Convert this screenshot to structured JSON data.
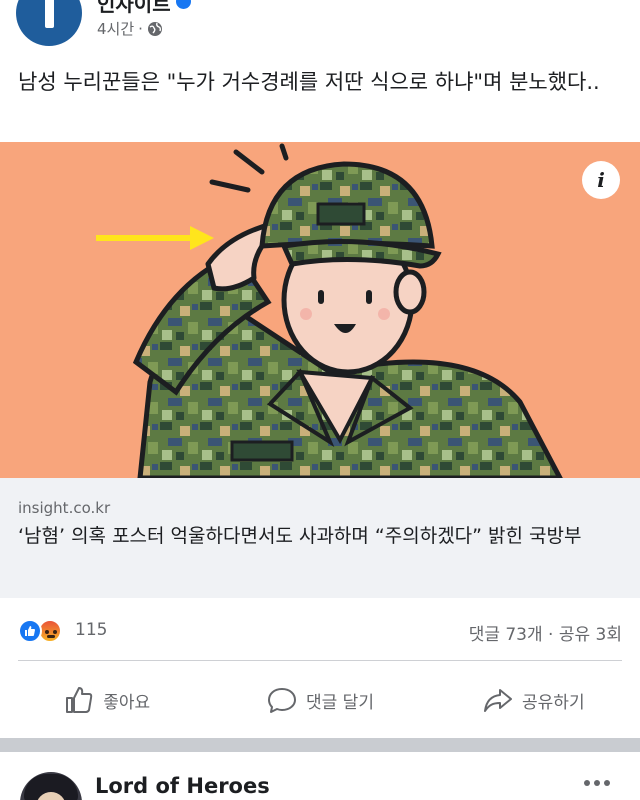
{
  "post": {
    "page_name": "인사이트",
    "time": "4시간",
    "meta_separator": "·",
    "text": "남성 누리꾼들은 \"누가 거수경례를 저딴 식으로 하냐\"며 분노했다..",
    "link": {
      "domain": "insight.co.kr",
      "title": "‘남혐’ 의혹 포스터 억울하다면서도 사과하며 “주의하겠다” 밝힌 국방부",
      "info_label": "i"
    },
    "reactions": {
      "count": "115",
      "comments_shares": "댓글 73개 · 공유 3회"
    },
    "actions": {
      "like": "좋아요",
      "comment": "댓글 달기",
      "share": "공유하기"
    }
  },
  "next_post": {
    "page_name": "Lord of Heroes"
  },
  "colors": {
    "image_background": "#f8a57c",
    "camo_green": "#5d7a43",
    "arrow_yellow": "#ffe51c",
    "facebook_blue": "#1877f2"
  },
  "icons": {
    "info": "info-icon",
    "globe": "globe-icon",
    "like": "thumbs-up-icon",
    "comment": "speech-bubble-icon",
    "share": "share-arrow-icon",
    "more": "more-dots-icon"
  }
}
